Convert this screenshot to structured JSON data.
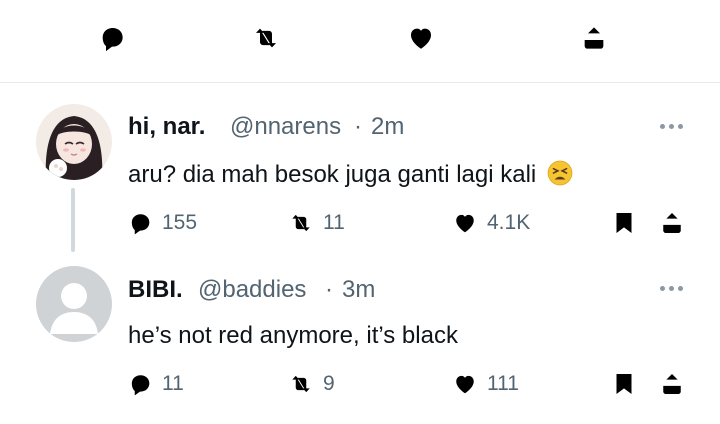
{
  "top_actions": [
    "reply-icon",
    "retweet-icon",
    "like-icon",
    "share-icon"
  ],
  "replies": [
    {
      "display_name": "hi, nar.",
      "handle": "@nnarens",
      "separator": "·",
      "time": "2m",
      "text": "aru? dia mah besok juga ganti lagi kali",
      "emoji": "😫",
      "reply_count": "155",
      "retweet_count": "11",
      "like_count": "4.1K"
    },
    {
      "display_name": "BIBI.",
      "handle": "@baddies",
      "separator": "·",
      "time": "3m",
      "text": "he’s not red anymore, it’s black",
      "reply_count": "11",
      "retweet_count": "9",
      "like_count": "111"
    }
  ],
  "colors": {
    "text": "#0f1419",
    "secondary": "#536471",
    "divider": "#e6ebee",
    "thread_line": "#cfd9de"
  }
}
